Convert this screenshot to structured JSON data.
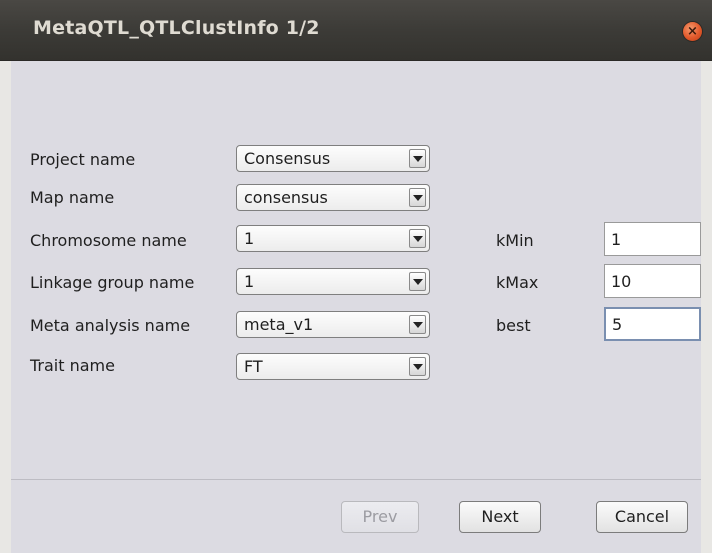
{
  "window": {
    "title": "MetaQTL_QTLClustInfo 1/2",
    "close_icon": "close-icon"
  },
  "form": {
    "fields": [
      {
        "label": "Project name",
        "value": "Consensus"
      },
      {
        "label": "Map name",
        "value": "consensus"
      },
      {
        "label": "Chromosome name",
        "value": "1"
      },
      {
        "label": "Linkage group name",
        "value": "1"
      },
      {
        "label": "Meta analysis name",
        "value": "meta_v1"
      },
      {
        "label": "Trait name",
        "value": "FT"
      }
    ],
    "params": [
      {
        "label": "kMin",
        "value": "1"
      },
      {
        "label": "kMax",
        "value": "10"
      },
      {
        "label": "best",
        "value": "5"
      }
    ]
  },
  "buttons": {
    "prev": "Prev",
    "next": "Next",
    "cancel": "Cancel"
  },
  "colors": {
    "titlebar": "#3c3b37",
    "close_button": "#e2582a",
    "focus_border": "#7a8fb0"
  }
}
